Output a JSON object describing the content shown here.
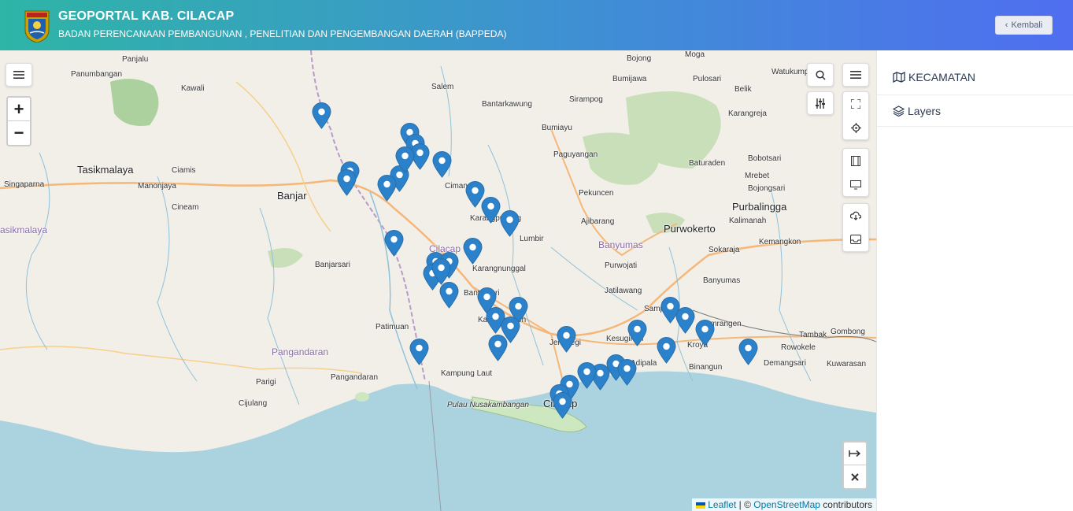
{
  "header": {
    "title": "GEOPORTAL KAB. CILACAP",
    "subtitle": "BADAN PERENCANAAN PEMBANGUNAN , PENELITIAN DAN PENGEMBANGAN DAERAH (BAPPEDA)",
    "back_label": "Kembali",
    "logo_text": "CILACAP"
  },
  "sidebar": {
    "items": [
      {
        "label": "KECAMATAN",
        "icon": "map-icon"
      },
      {
        "label": "Layers",
        "icon": "layers-icon"
      }
    ]
  },
  "map": {
    "attribution": {
      "leaflet": "Leaflet",
      "sep": " | © ",
      "osm": "OpenStreetMap",
      "suffix": " contributors"
    },
    "zoom_in": "+",
    "zoom_out": "−",
    "labels": [
      {
        "text": "Panjalu",
        "cls": ""
      },
      {
        "text": "Panumbangan",
        "cls": ""
      },
      {
        "text": "Kawali",
        "cls": ""
      },
      {
        "text": "Tasikmalaya",
        "cls": "city"
      },
      {
        "text": "Ciamis",
        "cls": ""
      },
      {
        "text": "Singaparna",
        "cls": ""
      },
      {
        "text": "Manonjaya",
        "cls": ""
      },
      {
        "text": "Cineam",
        "cls": ""
      },
      {
        "text": "asikmalaya",
        "cls": "region"
      },
      {
        "text": "Banjar",
        "cls": "city"
      },
      {
        "text": "Banjarsari",
        "cls": ""
      },
      {
        "text": "Pangandaran",
        "cls": "region"
      },
      {
        "text": "Parigi",
        "cls": ""
      },
      {
        "text": "Pangandaran",
        "cls": ""
      },
      {
        "text": "Cijulang",
        "cls": ""
      },
      {
        "text": "Patimuan",
        "cls": ""
      },
      {
        "text": "Salem",
        "cls": ""
      },
      {
        "text": "Bantarkawung",
        "cls": ""
      },
      {
        "text": "Cimanggu",
        "cls": ""
      },
      {
        "text": "Karangpucung",
        "cls": ""
      },
      {
        "text": "Cilacap",
        "cls": "region"
      },
      {
        "text": "Bantarsari",
        "cls": ""
      },
      {
        "text": "Kawunganten",
        "cls": ""
      },
      {
        "text": "Kampung Laut",
        "cls": ""
      },
      {
        "text": "Pulau Nusakambangan",
        "cls": "sea"
      },
      {
        "text": "Cilacap",
        "cls": "city"
      },
      {
        "text": "Bojong",
        "cls": ""
      },
      {
        "text": "Moga",
        "cls": ""
      },
      {
        "text": "Bumijawa",
        "cls": ""
      },
      {
        "text": "Pulosari",
        "cls": ""
      },
      {
        "text": "Watukumpul",
        "cls": ""
      },
      {
        "text": "Sirampog",
        "cls": ""
      },
      {
        "text": "Bumiayu",
        "cls": ""
      },
      {
        "text": "Belik",
        "cls": ""
      },
      {
        "text": "Paguyangan",
        "cls": ""
      },
      {
        "text": "Karangreja",
        "cls": ""
      },
      {
        "text": "Baturaden",
        "cls": ""
      },
      {
        "text": "Bobotsari",
        "cls": ""
      },
      {
        "text": "Mrebet",
        "cls": ""
      },
      {
        "text": "Bojongsari",
        "cls": ""
      },
      {
        "text": "Pekuncen",
        "cls": ""
      },
      {
        "text": "Purbalingga",
        "cls": "city"
      },
      {
        "text": "Lumbir",
        "cls": ""
      },
      {
        "text": "Ajibarang",
        "cls": ""
      },
      {
        "text": "Purwokerto",
        "cls": "city"
      },
      {
        "text": "Kalimanah",
        "cls": ""
      },
      {
        "text": "Banyumas",
        "cls": "region"
      },
      {
        "text": "Sokaraja",
        "cls": ""
      },
      {
        "text": "Kemangkon",
        "cls": ""
      },
      {
        "text": "Purwojati",
        "cls": ""
      },
      {
        "text": "Banyumas",
        "cls": ""
      },
      {
        "text": "Jatilawang",
        "cls": ""
      },
      {
        "text": "Sampang",
        "cls": ""
      },
      {
        "text": "Kemrangen",
        "cls": ""
      },
      {
        "text": "Tambak",
        "cls": ""
      },
      {
        "text": "Gombong",
        "cls": ""
      },
      {
        "text": "Jeruklegi",
        "cls": ""
      },
      {
        "text": "Kesugihan",
        "cls": ""
      },
      {
        "text": "Kroya",
        "cls": ""
      },
      {
        "text": "Rowokele",
        "cls": ""
      },
      {
        "text": "Adipala",
        "cls": ""
      },
      {
        "text": "Binangun",
        "cls": ""
      },
      {
        "text": "Demangsari",
        "cls": ""
      },
      {
        "text": "Kuwarasan",
        "cls": ""
      },
      {
        "text": "Karangnunggal",
        "cls": ""
      }
    ],
    "marker_count": 40
  }
}
